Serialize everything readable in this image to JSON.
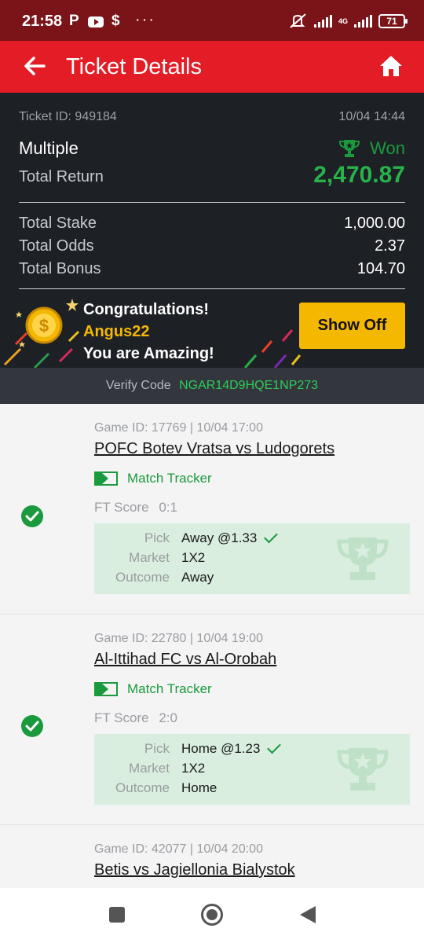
{
  "status_bar": {
    "time": "21:58",
    "network": "4G",
    "battery": "71"
  },
  "app_bar": {
    "title": "Ticket Details"
  },
  "ticket": {
    "id_label": "Ticket ID: 949184",
    "datetime": "10/04 14:44",
    "type": "Multiple",
    "status": "Won",
    "total_return_label": "Total Return",
    "total_return": "2,470.87",
    "rows": [
      {
        "label": "Total Stake",
        "value": "1,000.00"
      },
      {
        "label": "Total Odds",
        "value": "2.37"
      },
      {
        "label": "Total Bonus",
        "value": "104.70"
      }
    ]
  },
  "banner": {
    "line1": "Congratulations!",
    "username": "Angus22",
    "line3": "You are Amazing!",
    "button_label": "Show Off"
  },
  "verify": {
    "label": "Verify Code",
    "code": "NGAR14D9HQE1NP273"
  },
  "games": [
    {
      "meta": "Game ID: 17769 | 10/04 17:00",
      "title": "POFC Botev Vratsa vs Ludogorets",
      "tracker_label": "Match Tracker",
      "ft_label": "FT Score",
      "ft_score": "0:1",
      "pick_label": "Pick",
      "pick": "Away @1.33",
      "market_label": "Market",
      "market": "1X2",
      "outcome_label": "Outcome",
      "outcome": "Away"
    },
    {
      "meta": "Game ID: 22780 | 10/04 19:00",
      "title": "Al-Ittihad FC vs Al-Orobah",
      "tracker_label": "Match Tracker",
      "ft_label": "FT Score",
      "ft_score": "2:0",
      "pick_label": "Pick",
      "pick": "Home @1.23",
      "market_label": "Market",
      "market": "1X2",
      "outcome_label": "Outcome",
      "outcome": "Home"
    },
    {
      "meta": "Game ID: 42077 | 10/04 20:00",
      "title": "Betis vs Jagiellonia Bialystok"
    }
  ],
  "colors": {
    "brand_red": "#e41c25",
    "status_bar": "#7a1418",
    "summary_bg": "#1d2025",
    "won_green": "#1a9a3c",
    "return_green": "#27b24a",
    "show_off_yellow": "#f5b800",
    "verify_code_green": "#2ecc5a",
    "username_yellow": "#f5b800"
  }
}
